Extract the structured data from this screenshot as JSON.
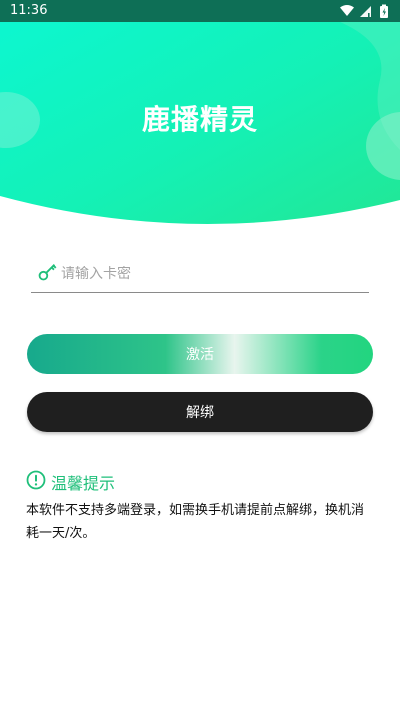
{
  "status_bar": {
    "time": "11:36",
    "icons": [
      "wifi-icon",
      "signal-icon",
      "battery-icon"
    ]
  },
  "header": {
    "title": "鹿播精灵"
  },
  "form": {
    "code_placeholder": "请输入卡密",
    "code_value": "",
    "activate_label": "激活",
    "unbind_label": "解绑"
  },
  "tips": {
    "title": "温馨提示",
    "text": "本软件不支持多端登录，如需换手机请提前点解绑，换机消耗一天/次。"
  },
  "colors": {
    "hero_light": "#0df5c8",
    "hero_mid": "#17f0b3",
    "hero_dark": "#1ee89a",
    "status_bar": "#0e6f56",
    "accent_green": "#1fbf7a",
    "unbind_button": "#1f1f1f"
  }
}
